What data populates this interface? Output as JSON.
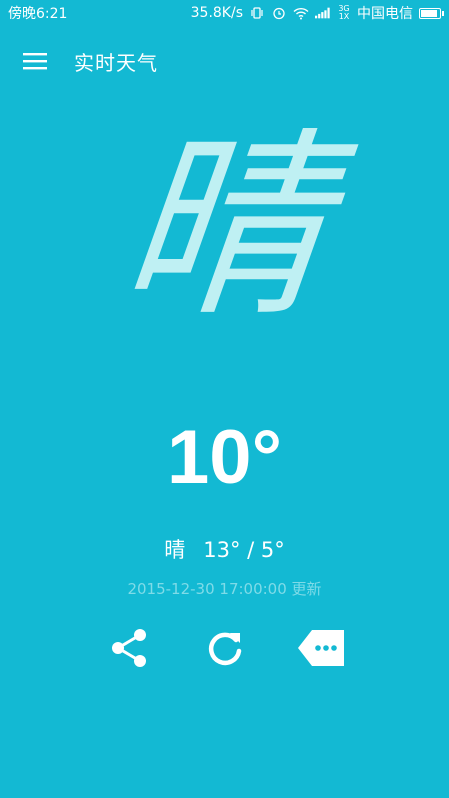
{
  "status": {
    "time": "傍晚6:21",
    "speed": "35.8K/s",
    "network_type": "3G 1X",
    "carrier": "中国电信"
  },
  "toolbar": {
    "title": "实时天气"
  },
  "weather": {
    "big_condition": "晴",
    "temperature": "10°",
    "condition": "晴",
    "range": "13° / 5°",
    "updated": "2015-12-30 17:00:00 更新"
  },
  "actions": [
    {
      "icon": "share-icon"
    },
    {
      "icon": "refresh-icon"
    },
    {
      "icon": "more-tag-icon"
    }
  ],
  "colors": {
    "background": "#13b9d3",
    "big_char": "#bff0f3",
    "muted": "#7fdbe8"
  }
}
